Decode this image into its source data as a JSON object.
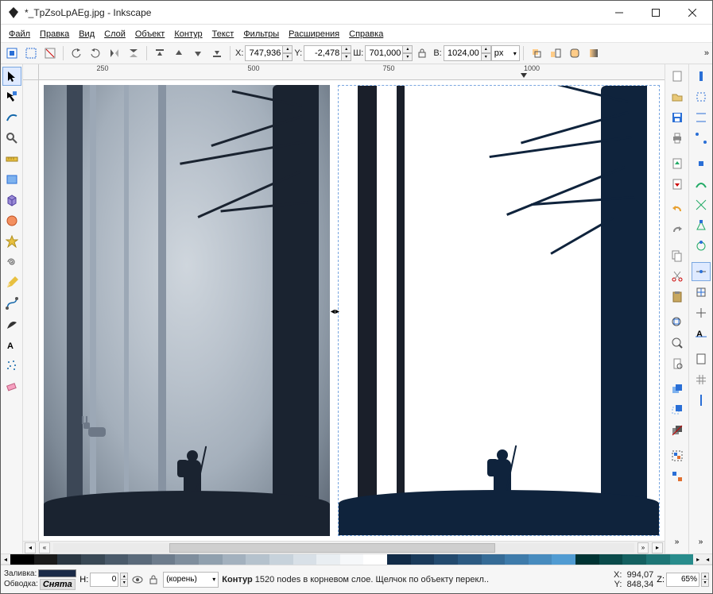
{
  "titlebar": {
    "title": "*_TpZsoLpAEg.jpg - Inkscape"
  },
  "menu": {
    "file": "Файл",
    "edit": "Правка",
    "view": "Вид",
    "layer": "Слой",
    "object": "Объект",
    "path": "Контур",
    "text": "Текст",
    "filters": "Фильтры",
    "extensions": "Расширения",
    "help": "Справка"
  },
  "toolbar": {
    "x_label": "X:",
    "x": "747,936",
    "y_label": "Y:",
    "y": "-2,478",
    "w_label": "Ш:",
    "w": "701,000",
    "h_label": "В:",
    "h": "1024,00",
    "unit": "px",
    "more": "»"
  },
  "ruler": {
    "m0": "250",
    "m1": "500",
    "m2": "750",
    "m3": "1000"
  },
  "status": {
    "fill_label": "Заливка:",
    "stroke_label": "Обводка:",
    "stroke_value": "Снята",
    "h_label": "Н:",
    "h_value": "0",
    "layer": "(корень)",
    "msg_bold": "Контур",
    "msg_rest": " 1520 nodes в корневом слое. Щелчок по объекту перекл..",
    "coord_x_label": "X:",
    "coord_x": "994,07",
    "coord_y_label": "Y:",
    "coord_y": "848,34",
    "z_label": "Z:",
    "z_value": "65%"
  },
  "palette": [
    "#000000",
    "#1a1a1a",
    "#2b3742",
    "#394855",
    "#4a5a6a",
    "#5a6a7a",
    "#6d7c8c",
    "#7f8e9d",
    "#90a0ae",
    "#a3b1be",
    "#b5c2cd",
    "#c7d2db",
    "#d8e0e7",
    "#e9eef2",
    "#f6f8fa",
    "#ffffff",
    "#112b47",
    "#1a3a5a",
    "#234a6e",
    "#2c5a82",
    "#356b96",
    "#3e7baa",
    "#478bbe",
    "#509bd2",
    "#003333",
    "#0a4a4a",
    "#146060",
    "#1e7676",
    "#288c8c"
  ]
}
